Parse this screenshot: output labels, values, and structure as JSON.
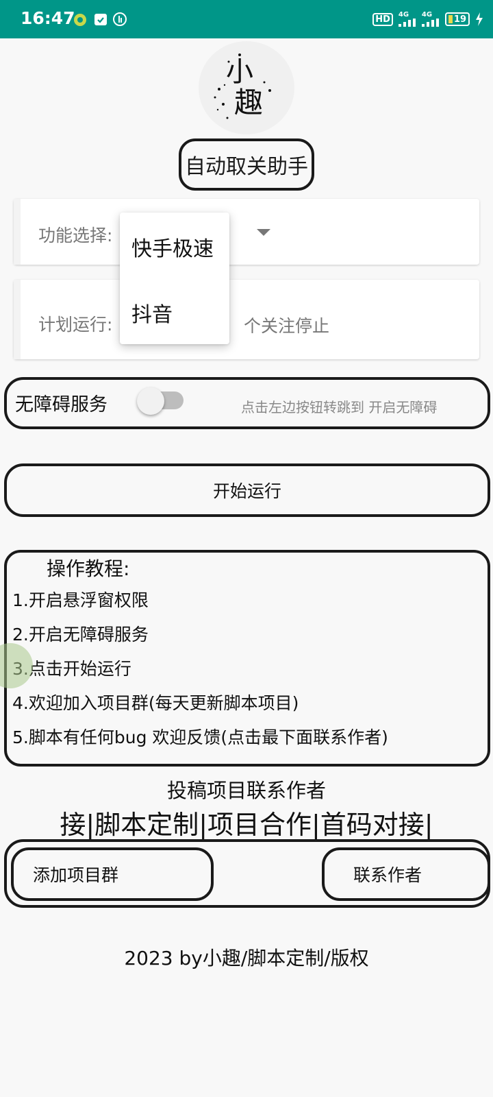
{
  "status_bar": {
    "time": "16:47",
    "battery": "19",
    "network_1": "4G",
    "network_2": "4G",
    "hd_badge": "HD"
  },
  "app": {
    "title": "自动取关助手",
    "logo_text": "小趣"
  },
  "function_select": {
    "label": "功能选择:",
    "options": [
      "快手极速",
      "抖音"
    ]
  },
  "plan_run": {
    "label": "计划运行:",
    "suffix": "个关注停止"
  },
  "accessibility": {
    "label": "无障碍服务",
    "hint": "点击左边按钮转跳到  开启无障碍",
    "enabled": false
  },
  "start_button": {
    "label": "开始运行"
  },
  "tutorial": {
    "title": "操作教程:",
    "steps": [
      "1.开启悬浮窗权限",
      "2.开启无障碍服务",
      "3.点击开始运行",
      "4.欢迎加入项目群(每天更新脚本项目)",
      "5.脚本有任何bug  欢迎反馈(点击最下面联系作者)"
    ]
  },
  "contact": {
    "line1": "投稿项目联系作者",
    "line2": "接|脚本定制|项目合作|首码对接|"
  },
  "buttons": {
    "join_group": "添加项目群",
    "contact_author": "联系作者"
  },
  "footer": "2023  by小趣/脚本定制/版权",
  "colors": {
    "status_bar": "#009688",
    "background": "#f8f8f8",
    "border": "#1a1a1a"
  }
}
